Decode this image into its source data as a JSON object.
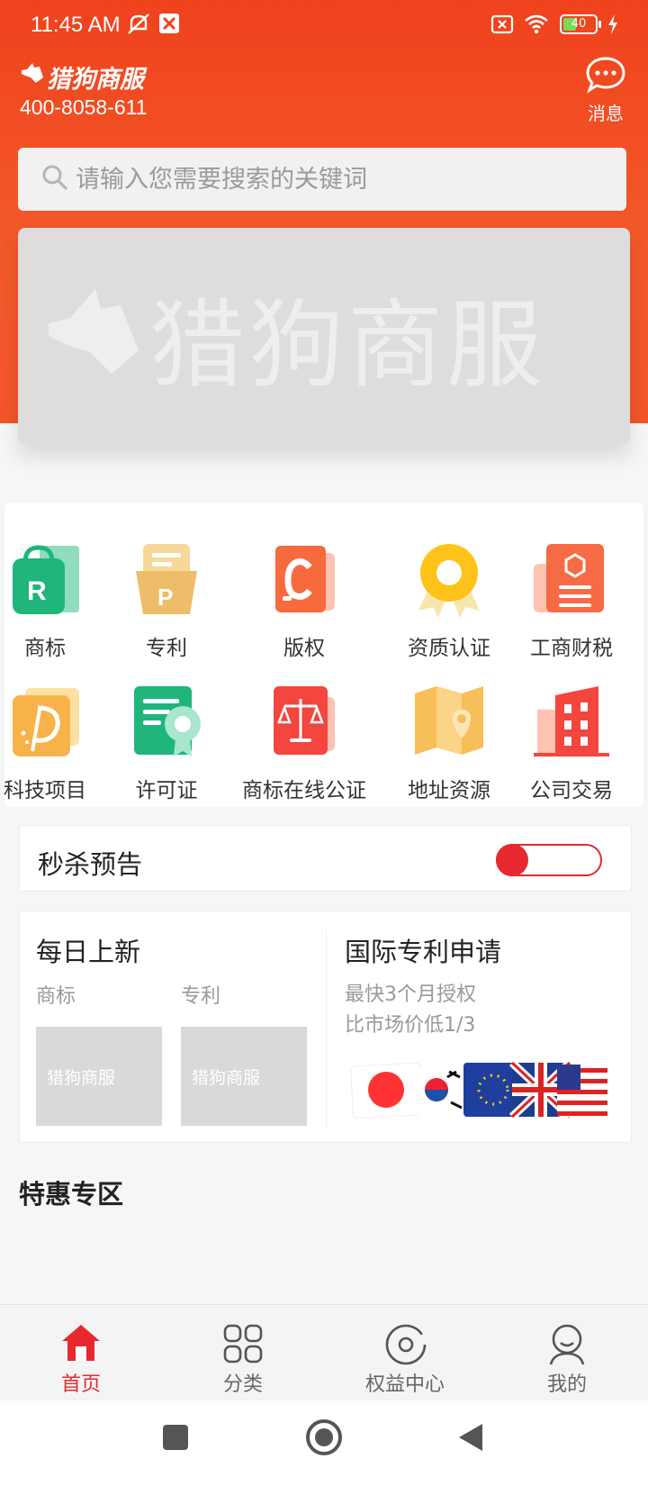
{
  "status_bar": {
    "time": "11:45 AM",
    "battery": "40"
  },
  "header": {
    "brand_name": "猎狗商服",
    "phone": "400-8058-611",
    "message_label": "消息"
  },
  "search": {
    "placeholder": "请输入您需要搜索的关键词"
  },
  "banner": {
    "watermark": "猎狗商服"
  },
  "categories": [
    {
      "label": "商标",
      "icon": "trademark-bag-icon"
    },
    {
      "label": "专利",
      "icon": "patent-box-icon"
    },
    {
      "label": "版权",
      "icon": "copyright-icon"
    },
    {
      "label": "资质认证",
      "icon": "certification-medal-icon"
    },
    {
      "label": "工商财税",
      "icon": "tax-document-icon"
    },
    {
      "label": "科技项目",
      "icon": "tech-project-icon"
    },
    {
      "label": "许可证",
      "icon": "license-icon"
    },
    {
      "label": "商标在线公证",
      "icon": "notary-scale-icon"
    },
    {
      "label": "地址资源",
      "icon": "map-location-icon"
    },
    {
      "label": "公司交易",
      "icon": "building-icon"
    }
  ],
  "flash_sale": {
    "title": "秒杀预告"
  },
  "daily_new": {
    "title": "每日上新",
    "items": [
      {
        "label": "商标",
        "thumb_text": "猎狗商服"
      },
      {
        "label": "专利",
        "thumb_text": "猎狗商服"
      }
    ]
  },
  "intl_patent": {
    "title": "国际专利申请",
    "line1": "最快3个月授权",
    "line2": "比市场价低1/3"
  },
  "special": {
    "title": "特惠专区"
  },
  "tabbar": [
    {
      "label": "首页",
      "icon": "home-icon",
      "active": true
    },
    {
      "label": "分类",
      "icon": "category-icon",
      "active": false
    },
    {
      "label": "权益中心",
      "icon": "benefits-icon",
      "active": false
    },
    {
      "label": "我的",
      "icon": "profile-icon",
      "active": false
    }
  ],
  "colors": {
    "brand_red": "#e8282f",
    "header_orange": "#f0421d"
  }
}
